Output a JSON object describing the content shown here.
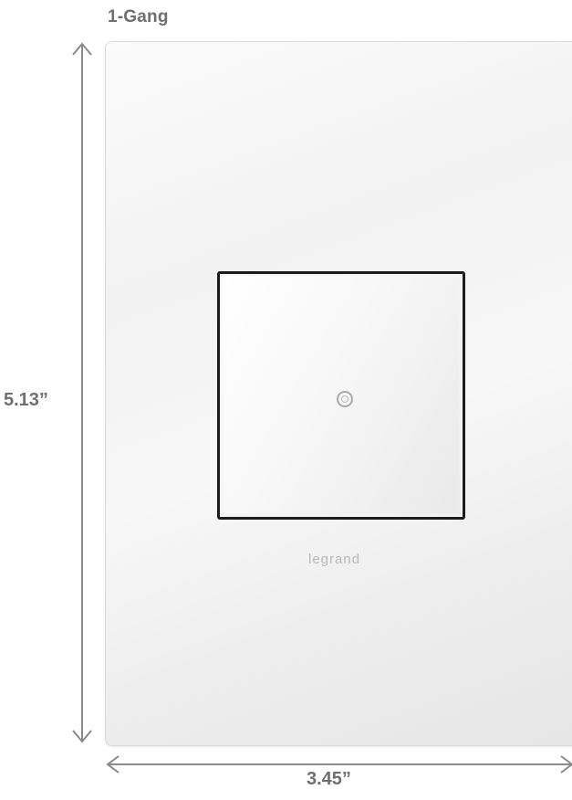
{
  "title": "1-Gang",
  "dimensions": {
    "height": "5.13”",
    "width": "3.45”"
  },
  "brand": "legrand",
  "colors": {
    "label_gray": "#6f6f6f",
    "plate_white": "#f4f4f4",
    "switch_border": "#1c1c1c"
  },
  "icons": {
    "indicator": "indicator-ring-icon"
  }
}
